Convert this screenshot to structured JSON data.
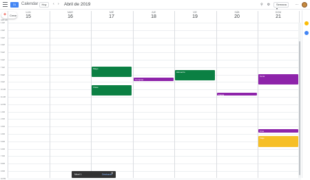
{
  "header": {
    "menu_icon": "hamburger-icon",
    "logo_icon": "calendar-logo-icon",
    "logo_text": "31",
    "app_title": "Calendar",
    "today_label": "Hoy",
    "prev_icon": "chevron-left-icon",
    "next_icon": "chevron-right-icon",
    "month_label": "Abril de 2019",
    "search_icon": "search-icon",
    "settings_icon": "gear-icon",
    "view_label": "Semana",
    "apps_icon": "apps-grid-icon"
  },
  "create": {
    "label": "Crear",
    "icon": "plus-icon"
  },
  "timezone": "GMT+02",
  "days": [
    {
      "name": "Lun",
      "date": "15"
    },
    {
      "name": "Mar",
      "date": "16"
    },
    {
      "name": "Mié",
      "date": "17"
    },
    {
      "name": "Jue",
      "date": "18"
    },
    {
      "name": "Vie",
      "date": "19"
    },
    {
      "name": "Sáb",
      "date": "20"
    },
    {
      "name": "Dom",
      "date": "21"
    }
  ],
  "hours": [
    "1 AM",
    "2 AM",
    "3 AM",
    "4 AM",
    "5 AM",
    "6 AM",
    "7 AM",
    "8 AM",
    "9 AM",
    "10 AM",
    "11 AM",
    "12 PM",
    "1 PM",
    "2 PM",
    "3 PM",
    "4 PM",
    "5 PM",
    "6 PM",
    "7 PM",
    "8 PM",
    "9 PM",
    "10 PM"
  ],
  "events": [
    {
      "title": "Mago",
      "day": 2,
      "color": "#0b8043"
    },
    {
      "title": "Clase",
      "day": 2,
      "color": "#0b8043"
    },
    {
      "title": "Compras",
      "day": 3,
      "color": "#8e24aa"
    },
    {
      "title": "Almuerzo",
      "day": 4,
      "color": "#0b8043"
    },
    {
      "title": "Fiesta",
      "day": 5,
      "color": "#8e24aa"
    },
    {
      "title": "Cena",
      "day": 6,
      "color": "#8e24aa"
    },
    {
      "title": "Cine",
      "day": 6,
      "color": "#8e24aa"
    },
    {
      "title": "Viaje",
      "day": 6,
      "color": "#f6bf26"
    }
  ],
  "side_panel": [
    "keep-icon",
    "tasks-icon",
    "add-icon"
  ],
  "snackbar": {
    "message": "Nivel 1",
    "action": "Deshacer",
    "close_icon": "close-icon"
  }
}
